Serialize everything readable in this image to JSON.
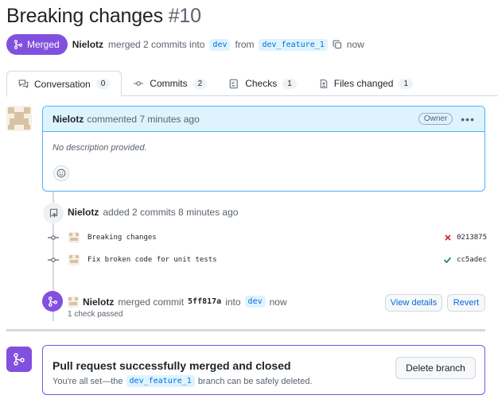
{
  "pr": {
    "title": "Breaking changes",
    "number": "#10",
    "status": "Merged",
    "author": "Nielotz",
    "merged_text": "merged 2 commits into",
    "base_branch": "dev",
    "from_text": "from",
    "head_branch": "dev_feature_1",
    "time": "now"
  },
  "tabs": [
    {
      "label": "Conversation",
      "count": "0"
    },
    {
      "label": "Commits",
      "count": "2"
    },
    {
      "label": "Checks",
      "count": "1"
    },
    {
      "label": "Files changed",
      "count": "1"
    }
  ],
  "comment": {
    "author": "Nielotz",
    "meta": "commented 7 minutes ago",
    "role": "Owner",
    "body": "No description provided."
  },
  "commits_event": {
    "author": "Nielotz",
    "text": "added 2 commits 8 minutes ago",
    "commits": [
      {
        "message": "Breaking changes",
        "sha": "0213875",
        "status": "fail"
      },
      {
        "message": "Fix broken code for unit tests",
        "sha": "cc5adec",
        "status": "pass"
      }
    ]
  },
  "merge_event": {
    "author": "Nielotz",
    "text": "merged commit",
    "sha": "5ff817a",
    "into": "into",
    "branch": "dev",
    "time": "now",
    "checks": "1 check passed",
    "view_details": "View details",
    "revert": "Revert"
  },
  "merge_box": {
    "heading": "Pull request successfully merged and closed",
    "prefix": "You're all set—the",
    "branch": "dev_feature_1",
    "suffix": "branch can be safely deleted.",
    "delete_button": "Delete branch"
  },
  "colors": {
    "merged": "#8250df",
    "link": "#0969da",
    "fail": "#d1242f",
    "pass": "#1a7f37"
  }
}
